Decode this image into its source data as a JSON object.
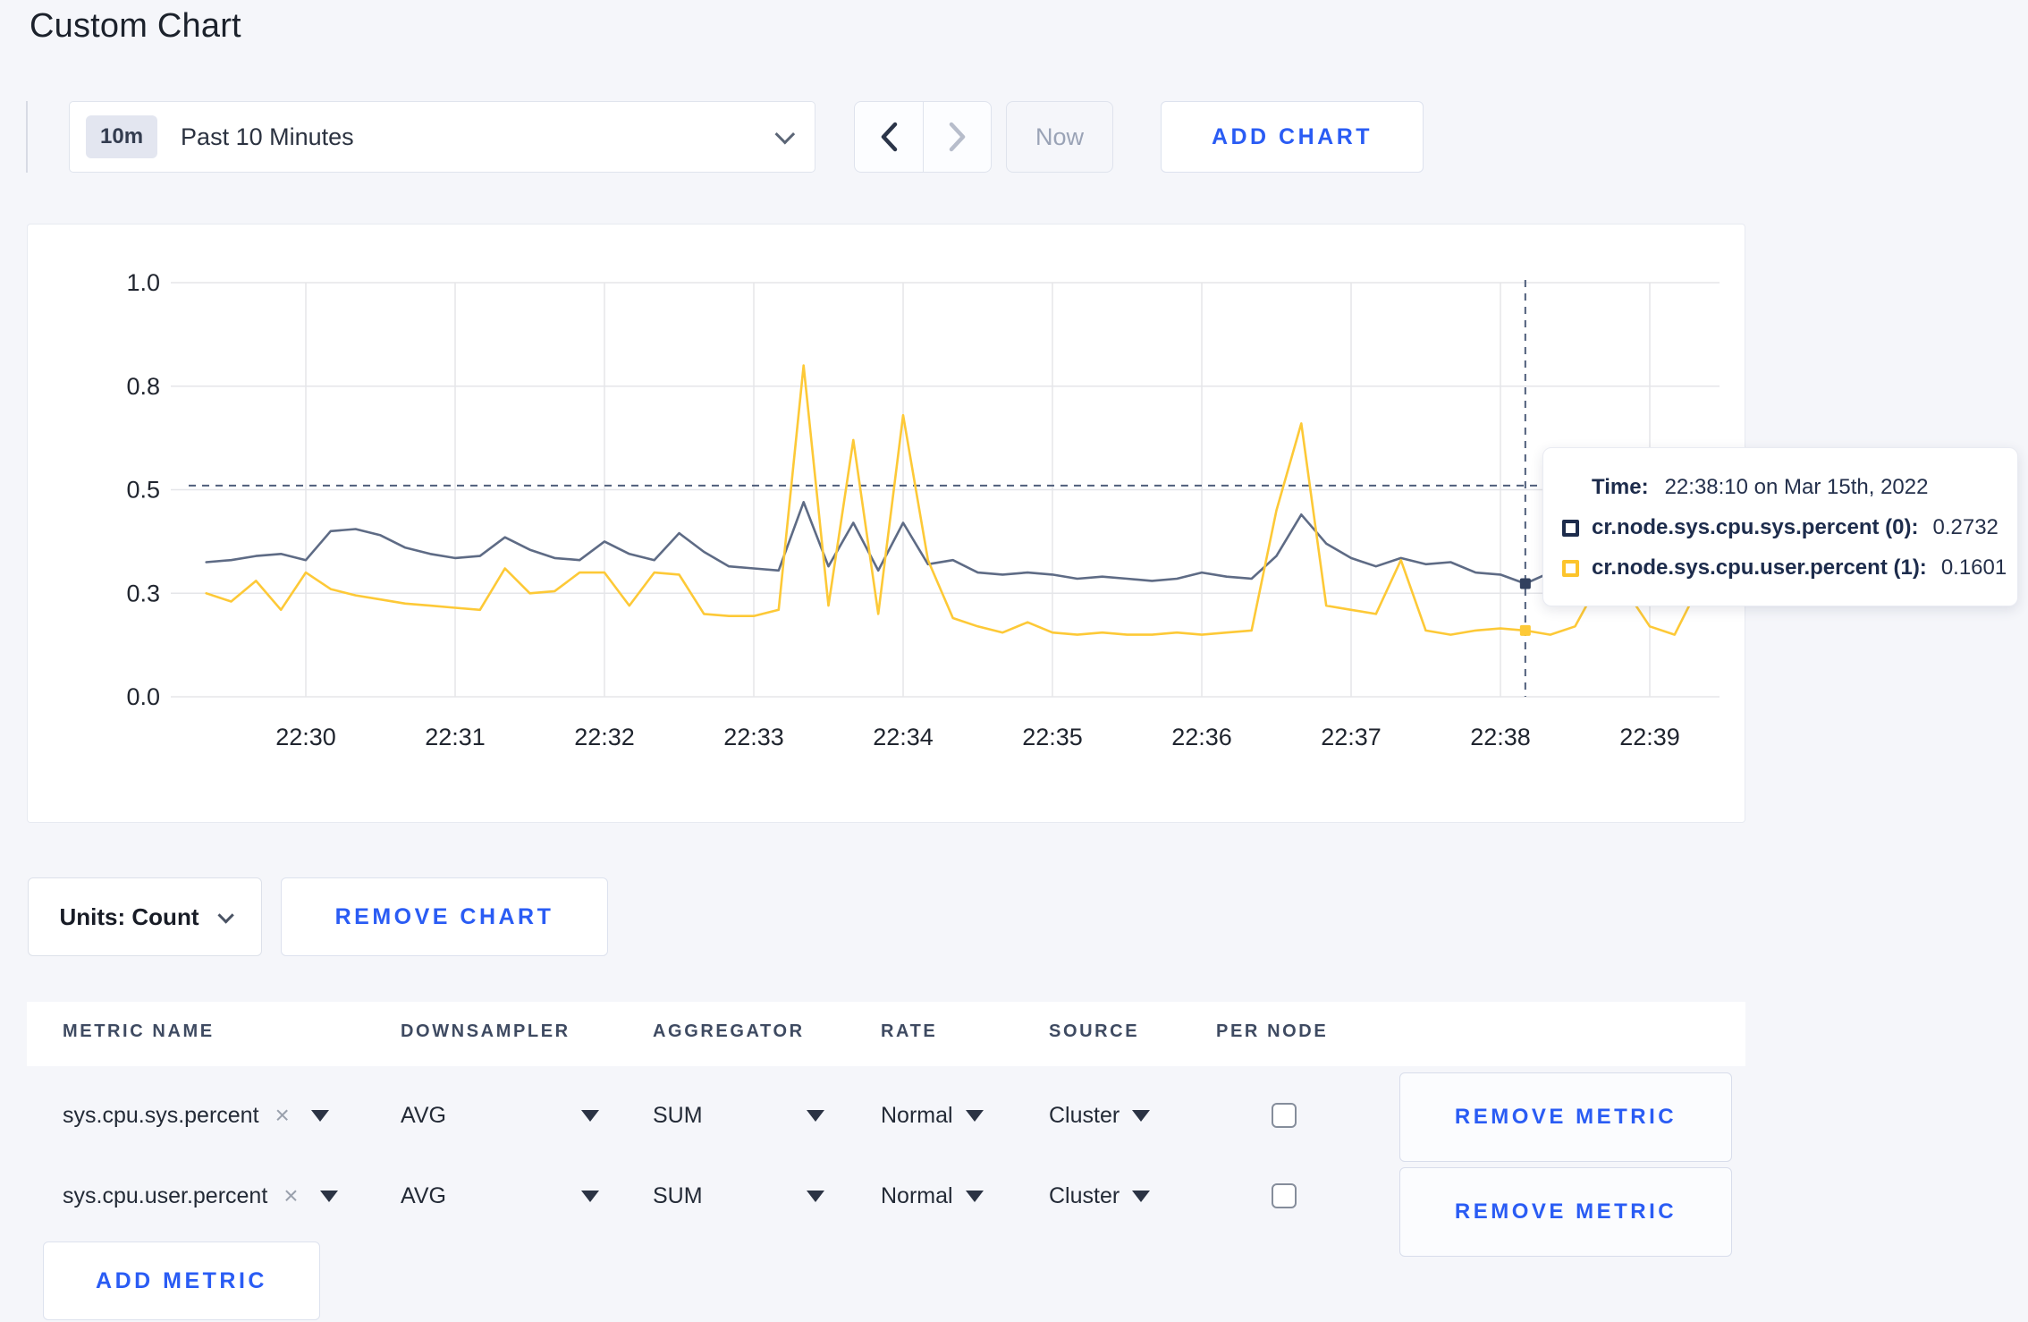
{
  "page": {
    "title": "Custom Chart"
  },
  "toolbar": {
    "time_range": {
      "badge": "10m",
      "label": "Past 10 Minutes"
    },
    "now_label": "Now",
    "add_chart_label": "ADD CHART"
  },
  "tooltip": {
    "time_label": "Time:",
    "time_value": "22:38:10 on Mar 15th, 2022",
    "rows": [
      {
        "label": "cr.node.sys.cpu.sys.percent (0):",
        "value": "0.2732"
      },
      {
        "label": "cr.node.sys.cpu.user.percent (1):",
        "value": "0.1601"
      }
    ]
  },
  "units_bar": {
    "units_label": "Units: Count",
    "remove_chart_label": "REMOVE CHART"
  },
  "metrics_table": {
    "headers": [
      "METRIC NAME",
      "DOWNSAMPLER",
      "AGGREGATOR",
      "RATE",
      "SOURCE",
      "PER NODE"
    ],
    "rows": [
      {
        "metric_name": "sys.cpu.sys.percent",
        "remove_symbol": "×",
        "downsampler": "AVG",
        "aggregator": "SUM",
        "rate": "Normal",
        "source": "Cluster",
        "per_node_checked": false,
        "remove_label": "REMOVE METRIC"
      },
      {
        "metric_name": "sys.cpu.user.percent",
        "remove_symbol": "×",
        "downsampler": "AVG",
        "aggregator": "SUM",
        "rate": "Normal",
        "source": "Cluster",
        "per_node_checked": false,
        "remove_label": "REMOVE METRIC"
      }
    ],
    "add_metric_label": "ADD METRIC"
  },
  "colors": {
    "accent_blue": "#2a5cf4",
    "series_sys": "#5e6b85",
    "series_user": "#fdc937",
    "tooltip_navy": "#1d2c4c",
    "page_bg": "#f5f6fa"
  },
  "chart_data": {
    "type": "line",
    "title": "",
    "xlabel": "",
    "ylabel": "",
    "ylim": [
      0,
      1
    ],
    "grid": true,
    "legend_position": "tooltip",
    "y_ticks": [
      {
        "value": 0,
        "label": "0.0"
      },
      {
        "value": 0.25,
        "label": "0.3"
      },
      {
        "value": 0.5,
        "label": "0.5"
      },
      {
        "value": 0.75,
        "label": "0.8"
      },
      {
        "value": 1.0,
        "label": "1.0"
      }
    ],
    "x_ticks": [
      "22:30",
      "22:31",
      "22:32",
      "22:33",
      "22:34",
      "22:35",
      "22:36",
      "22:37",
      "22:38",
      "22:39"
    ],
    "x_times": [
      "22:29:20",
      "22:29:30",
      "22:29:40",
      "22:29:50",
      "22:30:00",
      "22:30:10",
      "22:30:20",
      "22:30:30",
      "22:30:40",
      "22:30:50",
      "22:31:00",
      "22:31:10",
      "22:31:20",
      "22:31:30",
      "22:31:40",
      "22:31:50",
      "22:32:00",
      "22:32:10",
      "22:32:20",
      "22:32:30",
      "22:32:40",
      "22:32:50",
      "22:33:00",
      "22:33:10",
      "22:33:20",
      "22:33:30",
      "22:33:40",
      "22:33:50",
      "22:34:00",
      "22:34:10",
      "22:34:20",
      "22:34:30",
      "22:34:40",
      "22:34:50",
      "22:35:00",
      "22:35:10",
      "22:35:20",
      "22:35:30",
      "22:35:40",
      "22:35:50",
      "22:36:00",
      "22:36:10",
      "22:36:20",
      "22:36:30",
      "22:36:40",
      "22:36:50",
      "22:37:00",
      "22:37:10",
      "22:37:20",
      "22:37:30",
      "22:37:40",
      "22:37:50",
      "22:38:00",
      "22:38:10",
      "22:38:20",
      "22:38:30",
      "22:38:40",
      "22:38:50",
      "22:39:00",
      "22:39:10",
      "22:39:20",
      "22:39:30"
    ],
    "series": [
      {
        "name": "cr.node.sys.cpu.sys.percent",
        "color": "#5e6b85",
        "marker_color": "#31405e",
        "values": [
          0.325,
          0.33,
          0.34,
          0.345,
          0.33,
          0.4,
          0.405,
          0.39,
          0.36,
          0.345,
          0.335,
          0.34,
          0.385,
          0.355,
          0.335,
          0.33,
          0.375,
          0.345,
          0.33,
          0.395,
          0.35,
          0.315,
          0.31,
          0.305,
          0.47,
          0.315,
          0.42,
          0.305,
          0.42,
          0.32,
          0.33,
          0.3,
          0.295,
          0.3,
          0.295,
          0.285,
          0.29,
          0.285,
          0.28,
          0.285,
          0.3,
          0.29,
          0.285,
          0.34,
          0.44,
          0.37,
          0.335,
          0.315,
          0.335,
          0.32,
          0.325,
          0.3,
          0.295,
          0.2732,
          0.3,
          0.31,
          0.315,
          0.31,
          0.3,
          0.315,
          0.3,
          0.305
        ]
      },
      {
        "name": "cr.node.sys.cpu.user.percent",
        "color": "#fdc937",
        "marker_color": "#fdc937",
        "values": [
          0.25,
          0.23,
          0.28,
          0.21,
          0.3,
          0.26,
          0.245,
          0.235,
          0.225,
          0.22,
          0.215,
          0.21,
          0.31,
          0.25,
          0.255,
          0.3,
          0.3,
          0.22,
          0.3,
          0.295,
          0.2,
          0.195,
          0.195,
          0.21,
          0.8,
          0.22,
          0.62,
          0.2,
          0.68,
          0.33,
          0.19,
          0.17,
          0.155,
          0.18,
          0.155,
          0.15,
          0.155,
          0.15,
          0.15,
          0.155,
          0.15,
          0.155,
          0.16,
          0.45,
          0.66,
          0.22,
          0.21,
          0.2,
          0.33,
          0.16,
          0.15,
          0.16,
          0.165,
          0.1601,
          0.15,
          0.17,
          0.28,
          0.26,
          0.17,
          0.15,
          0.27,
          0.245
        ]
      }
    ],
    "crosshair": {
      "time": "22:38:10",
      "hline_value": 0.51,
      "markers": [
        {
          "series": "cr.node.sys.cpu.sys.percent",
          "value": 0.2732
        },
        {
          "series": "cr.node.sys.cpu.user.percent",
          "value": 0.1601
        }
      ]
    }
  }
}
